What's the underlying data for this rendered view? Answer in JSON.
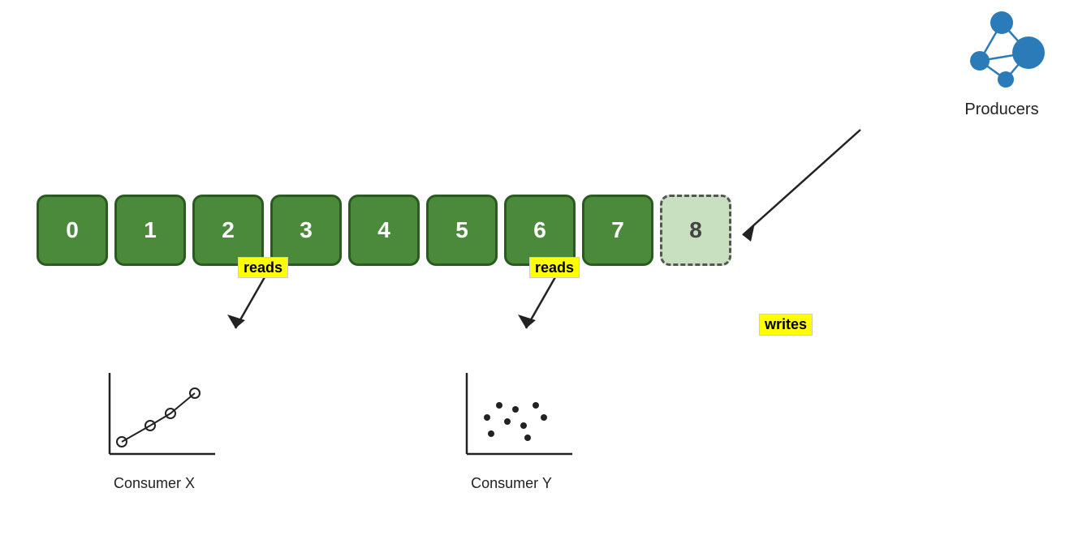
{
  "queue": {
    "blocks": [
      {
        "id": "0",
        "empty": false
      },
      {
        "id": "1",
        "empty": false
      },
      {
        "id": "2",
        "empty": false
      },
      {
        "id": "3",
        "empty": false
      },
      {
        "id": "4",
        "empty": false
      },
      {
        "id": "5",
        "empty": false
      },
      {
        "id": "6",
        "empty": false
      },
      {
        "id": "7",
        "empty": false
      },
      {
        "id": "8",
        "empty": true
      }
    ]
  },
  "producers": {
    "label": "Producers"
  },
  "writes": {
    "label": "writes"
  },
  "reads1": {
    "label": "reads"
  },
  "reads2": {
    "label": "reads"
  },
  "consumer_x": {
    "label": "Consumer X"
  },
  "consumer_y": {
    "label": "Consumer Y"
  },
  "colors": {
    "green_fill": "#4a8a3a",
    "green_border": "#2a5a20",
    "yellow": "#ffff00",
    "blue": "#2b7bb9"
  }
}
